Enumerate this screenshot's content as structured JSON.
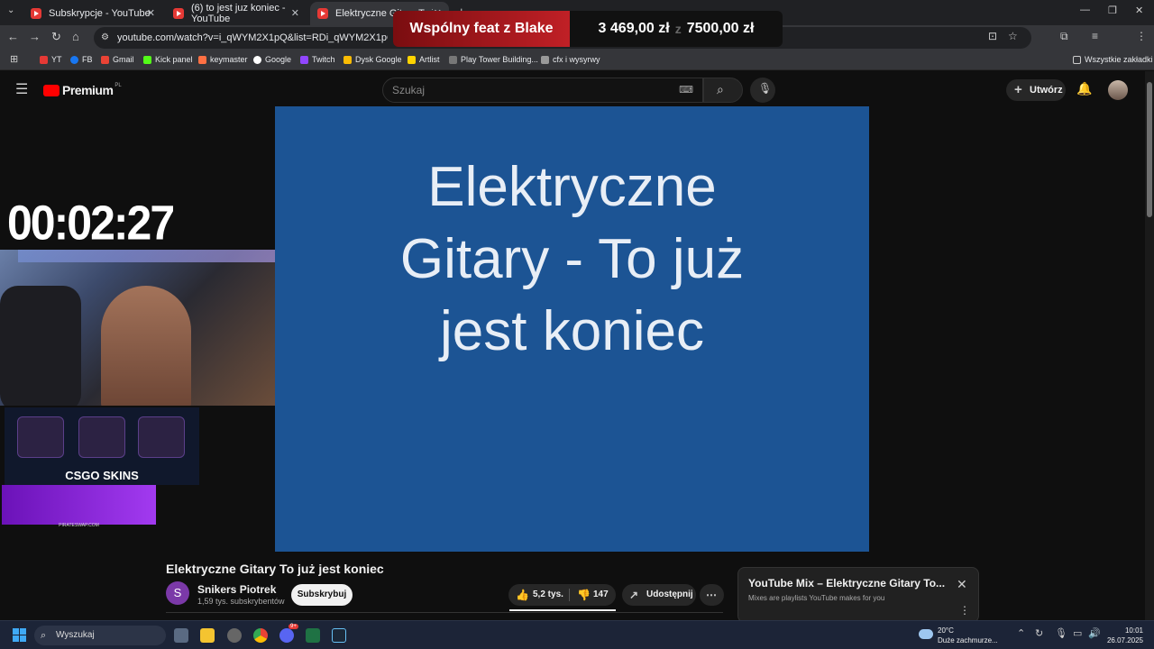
{
  "browser": {
    "tabs": [
      {
        "label": "Subskrypcje - YouTube"
      },
      {
        "label": "(6) to jest juz koniec - YouTube"
      },
      {
        "label": "Elektryczne Gitary To już je"
      }
    ],
    "url": "youtube.com/watch?v=i_qWYM2X1pQ&list=RDi_qWYM2X1pQ&start_radio",
    "bookmarks": [
      {
        "label": "YT"
      },
      {
        "label": "FB"
      },
      {
        "label": "Gmail"
      },
      {
        "label": "Kick panel"
      },
      {
        "label": "keymaster"
      },
      {
        "label": "Google"
      },
      {
        "label": "Twitch"
      },
      {
        "label": "Dysk Google"
      },
      {
        "label": "Artlist"
      },
      {
        "label": "Play Tower Building..."
      },
      {
        "label": "cfx i wysyrwy"
      }
    ],
    "all_bookmarks": "Wszystkie zakładki"
  },
  "overlay": {
    "goal_title": "Wspólny feat z Blake",
    "current_amount": "3 469,00 zł",
    "separator": "z",
    "target_amount": "7500,00 zł",
    "timer": "00:02:27",
    "sponsor_csgo": "CSGO SKINS",
    "sponsor_pirate": "PIRATESWAP.COM"
  },
  "youtube": {
    "logo": "Premium",
    "logo_region": "PL",
    "search_placeholder": "Szukaj",
    "create_label": "Utwórz",
    "video_frame_text": [
      "Elektryczne",
      "Gitary - To już",
      "jest koniec"
    ],
    "video_title": "Elektryczne Gitary To już jest koniec",
    "channel": {
      "initial": "S",
      "name": "Snikers Piotrek",
      "subscribers": "1,59 tys. subskrybentów"
    },
    "subscribe_label": "Subskrybuj",
    "likes": "5,2 tys.",
    "dislikes": "147",
    "share_label": "Udostępnij",
    "mix": {
      "title": "YouTube Mix – Elektryczne Gitary To...",
      "subtitle": "Mixes are playlists YouTube makes for you"
    }
  },
  "taskbar": {
    "search_placeholder": "Wyszukaj",
    "weather_temp": "20°C",
    "weather_desc": "Duże zachmurze...",
    "time": "10:01",
    "date": "26.07.2025",
    "discord_badge": "9+"
  },
  "colors": {
    "video_bg": "#1c5494",
    "yt_red": "#ff0000",
    "overlay_red": "#c02026"
  }
}
